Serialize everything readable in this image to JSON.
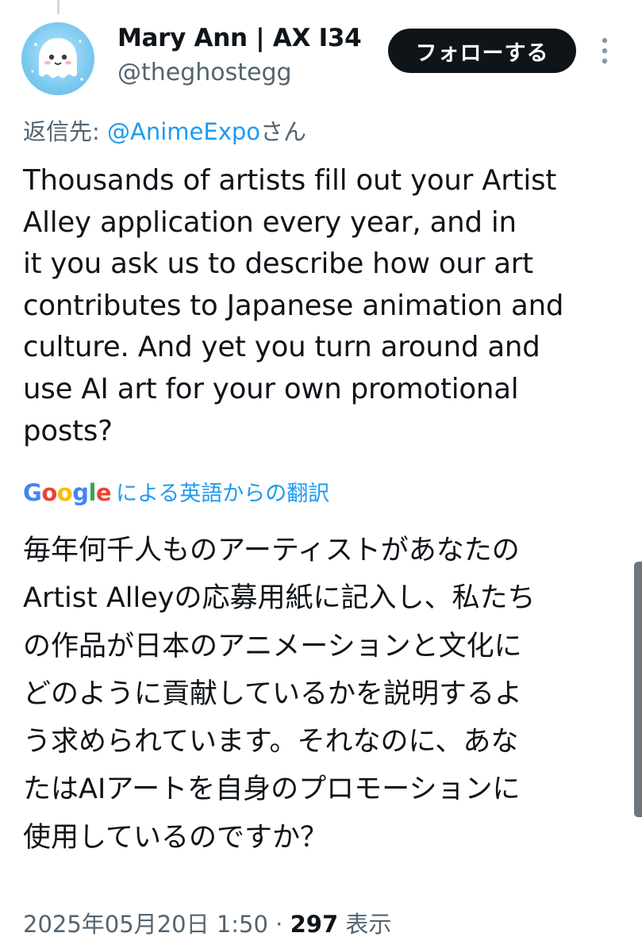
{
  "author": {
    "name": "Mary Ann | AX I34",
    "handle": "@theghostegg",
    "avatar_icon": "ghost-egg-avatar"
  },
  "follow_button": {
    "label": "フォローする"
  },
  "more_icon": "more-vertical-icon",
  "reply": {
    "prefix": "返信先: ",
    "mention": "@AnimeExpo",
    "suffix": "さん"
  },
  "tweet": {
    "text": "Thousands of artists fill out your Artist\nAlley application every year, and in\nit you ask us to describe how our art\ncontributes to Japanese animation and\nculture. And yet you turn around and\nuse AI art for your own promotional\nposts?"
  },
  "translation": {
    "provider": "Google",
    "label": "による英語からの翻訳",
    "text": "毎年何千人ものアーティストがあなたの\nArtist Alleyの応募用紙に記入し、私たち\nの作品が日本のアニメーションと文化に\nどのように貢献しているかを説明するよ\nう求められています。それなのに、あな\nたはAIアートを自身のプロモーションに\n使用しているのですか？"
  },
  "meta": {
    "timestamp": "2025年05月20日 1:50",
    "separator": " · ",
    "views_count": "297",
    "views_label": " 表示"
  },
  "colors": {
    "accent": "#1d9bf0",
    "secondary_text": "#536471",
    "primary_text": "#0f1419",
    "button_bg": "#0f1419"
  }
}
